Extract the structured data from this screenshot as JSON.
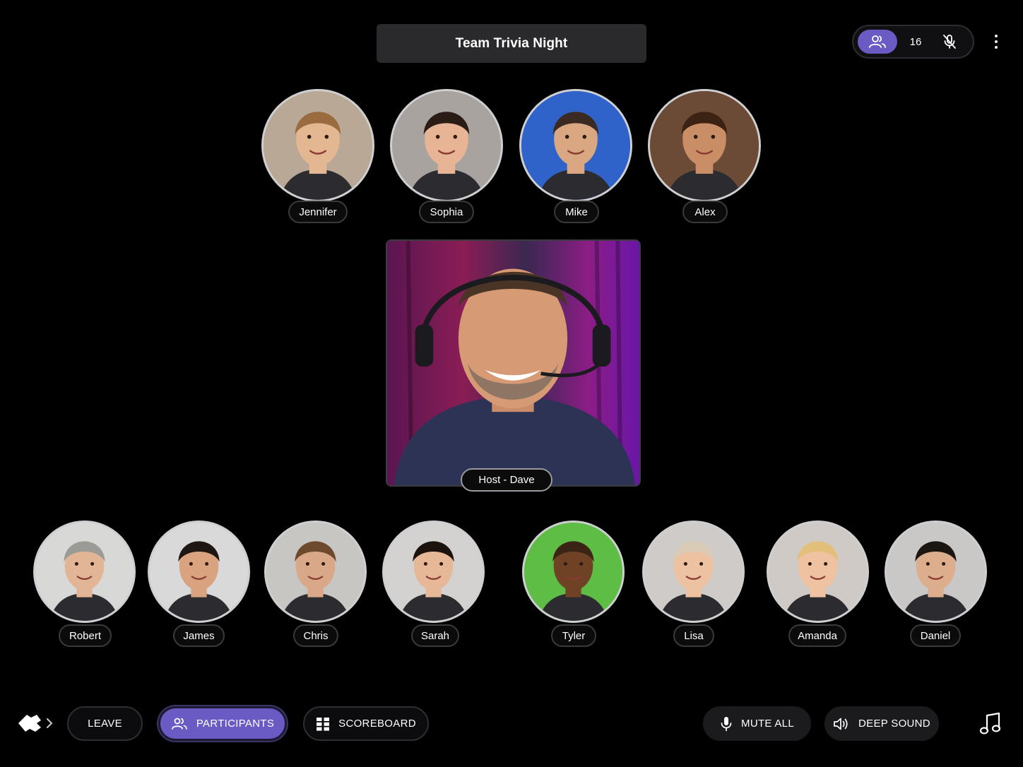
{
  "meeting": {
    "title": "Team Trivia Night"
  },
  "status": {
    "participant_count": "16",
    "icons": [
      "people-icon",
      "mic-off-icon",
      "more-vertical-icon"
    ],
    "accent_color": "#6a5bc4"
  },
  "top_row": [
    {
      "name": "Jennifer",
      "bg": "#b9a896",
      "skin": "#e3b792",
      "hair": "#9a6b3f"
    },
    {
      "name": "Sophia",
      "bg": "#a9a39f",
      "skin": "#e7b595",
      "hair": "#2a1b14"
    },
    {
      "name": "Mike",
      "bg": "#2f63c9",
      "skin": "#d9a883",
      "hair": "#3a2a22"
    },
    {
      "name": "Alex",
      "bg": "#6b4a36",
      "skin": "#c98e66",
      "hair": "#3c2213"
    }
  ],
  "host": {
    "label": "Host - Dave"
  },
  "bottom_row": [
    {
      "name": "Robert",
      "bg": "#d8d8d6",
      "skin": "#e2b596",
      "hair": "#9b9b96"
    },
    {
      "name": "James",
      "bg": "#d9d9d9",
      "skin": "#d9a37f",
      "hair": "#1e1612"
    },
    {
      "name": "Chris",
      "bg": "#c8c6c2",
      "skin": "#d9a888",
      "hair": "#6d4a2e"
    },
    {
      "name": "Sarah",
      "bg": "#d4d2d0",
      "skin": "#e6b898",
      "hair": "#1b120e"
    },
    {
      "name": "Tyler",
      "bg": "#5dbd45",
      "skin": "#6f4226",
      "hair": "#3a2416"
    },
    {
      "name": "Lisa",
      "bg": "#cfcbc8",
      "skin": "#ecc2a2",
      "hair": "#d9cbb5"
    },
    {
      "name": "Amanda",
      "bg": "#cfcac6",
      "skin": "#efc3a2",
      "hair": "#e2c07c"
    },
    {
      "name": "Daniel",
      "bg": "#c9c8c7",
      "skin": "#dcae8e",
      "hair": "#1c1612"
    }
  ],
  "controls": {
    "leave": "LEAVE",
    "participants": "PARTICIPANTS",
    "scoreboard": "SCOREBOARD",
    "mute_all": "MUTE ALL",
    "deep_sound": "DEEP SOUND"
  }
}
